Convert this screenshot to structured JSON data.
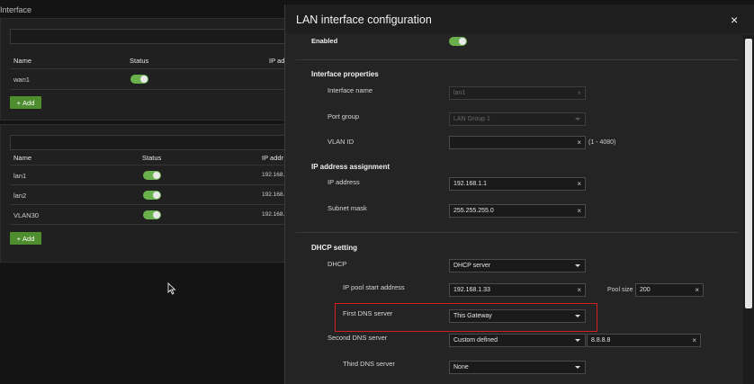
{
  "background": {
    "title": "Interface",
    "wan_table": {
      "headers": [
        "Name",
        "Status",
        "IP ad"
      ],
      "rows": [
        {
          "name": "wan1"
        }
      ]
    },
    "lan_table": {
      "headers": [
        "Name",
        "Status",
        "IP addr"
      ],
      "rows": [
        {
          "name": "lan1",
          "ip": "192.168.1"
        },
        {
          "name": "lan2",
          "ip": "192.168.2"
        },
        {
          "name": "VLAN30",
          "ip": "192.168.3"
        }
      ]
    },
    "add_label": "Add",
    "add_icon": "+"
  },
  "modal": {
    "title": "LAN interface configuration",
    "close_icon": "×",
    "enabled_label": "Enabled",
    "sections": {
      "interface_properties": "Interface properties",
      "ip_assignment": "IP address assignment",
      "dhcp_setting": "DHCP setting"
    },
    "fields": {
      "interface_name": {
        "label": "Interface name",
        "value": "lan1"
      },
      "port_group": {
        "label": "Port group",
        "value": "LAN Group 1"
      },
      "vlan_id": {
        "label": "VLAN ID",
        "value": "",
        "hint": "(1 - 4080)"
      },
      "ip_address": {
        "label": "IP address",
        "value": "192.168.1.1"
      },
      "subnet_mask": {
        "label": "Subnet mask",
        "value": "255.255.255.0"
      },
      "dhcp": {
        "label": "DHCP",
        "value": "DHCP server"
      },
      "ip_pool_start": {
        "label": "IP pool start address",
        "value": "192.168.1.33"
      },
      "pool_size": {
        "label": "Pool size",
        "value": "200"
      },
      "first_dns": {
        "label": "First DNS server",
        "value": "This Gateway"
      },
      "second_dns": {
        "label": "Second DNS server",
        "value": "Custom defined",
        "custom_value": "8.8.8.8"
      },
      "third_dns": {
        "label": "Third DNS server",
        "value": "None"
      }
    },
    "clear_icon": "×"
  },
  "colors": {
    "accent_green": "#6ab04c",
    "button_green": "#4e8e2f",
    "highlight_red": "#d11f1f"
  }
}
